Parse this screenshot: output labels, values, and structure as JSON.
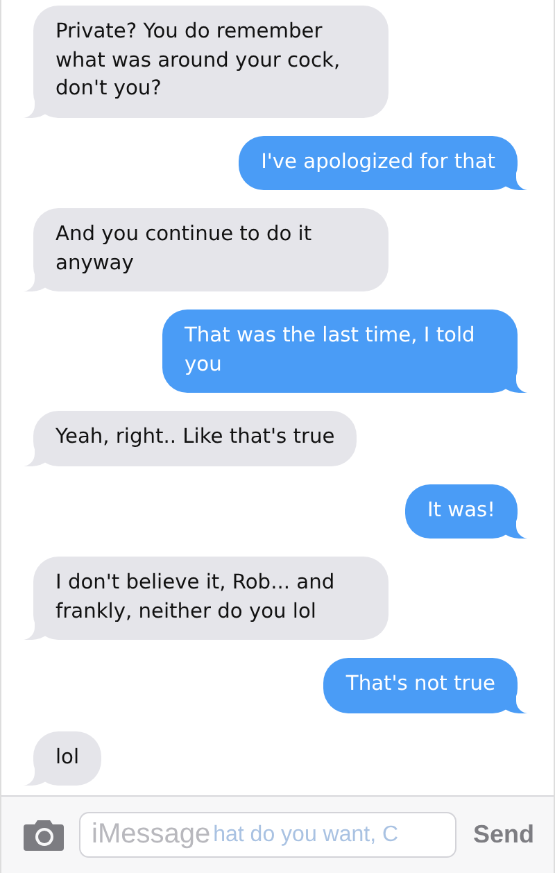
{
  "messages": [
    {
      "kind": "received",
      "text": "Private? You do remember what was around your cock, don't you?"
    },
    {
      "kind": "sent",
      "text": "I've apologized for that"
    },
    {
      "kind": "received",
      "text": "And you continue to do it anyway"
    },
    {
      "kind": "sent",
      "text": "That was the last time, I told you"
    },
    {
      "kind": "received",
      "text": "Yeah, right.. Like that's true"
    },
    {
      "kind": "sent",
      "text": "It was!"
    },
    {
      "kind": "received",
      "text": "I don't believe it, Rob... and frankly, neither do you lol"
    },
    {
      "kind": "sent",
      "text": "That's not true"
    },
    {
      "kind": "received",
      "text": "lol"
    }
  ],
  "composer": {
    "placeholder": "iMessage",
    "ghost_text": "hat do you want, C",
    "send": "Send"
  }
}
